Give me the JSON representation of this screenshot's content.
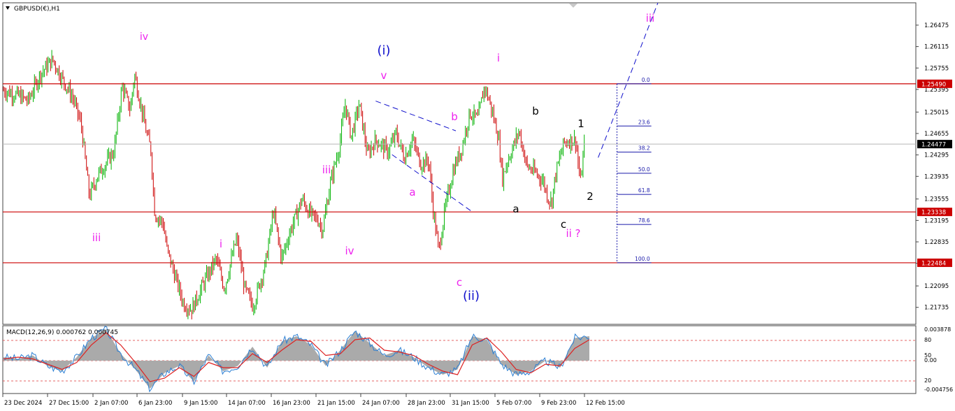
{
  "title": "GBPUSD(€),H1",
  "symbol_menu_icon": "triangle-down-icon",
  "colors": {
    "bull_candle": "#00b200",
    "bear_candle": "#cc0000",
    "hline": "#cc0000",
    "wave_magenta": "#ee22ee",
    "wave_blue": "#1010cc",
    "wave_black": "#000000",
    "fib": "#1a1aaa",
    "macd_hist": "#aaaaaa",
    "macd_line": "#2a7fd4",
    "signal_line": "#dd2222"
  },
  "chart_data": [
    {
      "type": "candlestick",
      "symbol": "GBPUSD",
      "timeframe": "H1",
      "ylim": [
        1.2145,
        1.2685
      ],
      "x_ticks": [
        "23 Dec 2024",
        "27 Dec 15:00",
        "2 Jan 07:00",
        "6 Jan 23:00",
        "9 Jan 15:00",
        "14 Jan 07:00",
        "16 Jan 23:00",
        "21 Jan 15:00",
        "24 Jan 07:00",
        "28 Jan 23:00",
        "31 Jan 15:00",
        "5 Feb 07:00",
        "9 Feb 23:00",
        "12 Feb 15:00"
      ],
      "y_ticks": [
        "1.26475",
        "1.26115",
        "1.25755",
        "1.25395",
        "1.25015",
        "1.24655",
        "1.24295",
        "1.23935",
        "1.23555",
        "1.23195",
        "1.22835",
        "1.22475",
        "1.22095",
        "1.21735"
      ],
      "price_labels": [
        "1.25490",
        "1.24477",
        "1.23338",
        "1.22484"
      ],
      "current_price": 1.24477,
      "horizontal_levels": [
        1.2549,
        1.23338,
        1.22484
      ],
      "path": [
        [
          0,
          1.2538
        ],
        [
          0.02,
          1.2528
        ],
        [
          0.03,
          1.252
        ],
        [
          0.045,
          1.2565
        ],
        [
          0.06,
          1.259
        ],
        [
          0.07,
          1.2562
        ],
        [
          0.085,
          1.2525
        ],
        [
          0.095,
          1.248
        ],
        [
          0.105,
          1.236
        ],
        [
          0.115,
          1.2395
        ],
        [
          0.135,
          1.2435
        ],
        [
          0.145,
          1.2545
        ],
        [
          0.155,
          1.2505
        ],
        [
          0.16,
          1.2565
        ],
        [
          0.175,
          1.2465
        ],
        [
          0.18,
          1.244
        ],
        [
          0.185,
          1.233
        ],
        [
          0.195,
          1.2315
        ],
        [
          0.2,
          1.227
        ],
        [
          0.21,
          1.2225
        ],
        [
          0.22,
          1.218
        ],
        [
          0.23,
          1.217
        ],
        [
          0.245,
          1.2215
        ],
        [
          0.26,
          1.2255
        ],
        [
          0.27,
          1.2205
        ],
        [
          0.285,
          1.229
        ],
        [
          0.295,
          1.2205
        ],
        [
          0.305,
          1.2175
        ],
        [
          0.32,
          1.2245
        ],
        [
          0.33,
          1.2335
        ],
        [
          0.34,
          1.2255
        ],
        [
          0.35,
          1.23
        ],
        [
          0.365,
          1.2355
        ],
        [
          0.375,
          1.233
        ],
        [
          0.385,
          1.232
        ],
        [
          0.39,
          1.2303
        ],
        [
          0.4,
          1.2385
        ],
        [
          0.41,
          1.244
        ],
        [
          0.418,
          1.2515
        ],
        [
          0.425,
          1.246
        ],
        [
          0.435,
          1.2515
        ],
        [
          0.445,
          1.243
        ],
        [
          0.455,
          1.2455
        ],
        [
          0.47,
          1.2435
        ],
        [
          0.48,
          1.2465
        ],
        [
          0.49,
          1.2425
        ],
        [
          0.5,
          1.2455
        ],
        [
          0.51,
          1.2415
        ],
        [
          0.52,
          1.242
        ],
        [
          0.525,
          1.234
        ],
        [
          0.53,
          1.229
        ],
        [
          0.532,
          1.2268
        ],
        [
          0.54,
          1.234
        ],
        [
          0.55,
          1.2405
        ],
        [
          0.56,
          1.244
        ],
        [
          0.57,
          1.25
        ],
        [
          0.58,
          1.249
        ],
        [
          0.588,
          1.2545
        ],
        [
          0.595,
          1.2515
        ],
        [
          0.605,
          1.246
        ],
        [
          0.61,
          1.239
        ],
        [
          0.615,
          1.2415
        ],
        [
          0.625,
          1.245
        ],
        [
          0.63,
          1.247
        ],
        [
          0.64,
          1.241
        ],
        [
          0.65,
          1.24
        ],
        [
          0.66,
          1.2385
        ],
        [
          0.665,
          1.236
        ],
        [
          0.67,
          1.235
        ],
        [
          0.675,
          1.2398
        ],
        [
          0.685,
          1.245
        ],
        [
          0.695,
          1.2455
        ],
        [
          0.7,
          1.2453
        ],
        [
          0.705,
          1.238
        ],
        [
          0.71,
          1.2445
        ]
      ],
      "annotations": [
        {
          "text": "iv",
          "color": "magenta"
        },
        {
          "text": "iii",
          "color": "magenta"
        },
        {
          "text": "i",
          "color": "magenta"
        },
        {
          "text": "iii",
          "color": "magenta"
        },
        {
          "text": "iv",
          "color": "magenta"
        },
        {
          "text": "v",
          "color": "magenta"
        },
        {
          "text": "(i)",
          "color": "blue"
        },
        {
          "text": "a",
          "color": "magenta"
        },
        {
          "text": "b",
          "color": "magenta"
        },
        {
          "text": "c",
          "color": "magenta"
        },
        {
          "text": "(ii)",
          "color": "blue"
        },
        {
          "text": "i",
          "color": "magenta"
        },
        {
          "text": "a",
          "color": "black"
        },
        {
          "text": "b",
          "color": "black"
        },
        {
          "text": "c",
          "color": "black"
        },
        {
          "text": "ii ?",
          "color": "magenta"
        },
        {
          "text": "1",
          "color": "black"
        },
        {
          "text": "2",
          "color": "black"
        },
        {
          "text": "iii",
          "color": "magenta"
        }
      ],
      "fibonacci": {
        "from": 1.22484,
        "to": 1.2549,
        "levels": [
          {
            "label": "0.0",
            "ratio": 0
          },
          {
            "label": "23.6",
            "ratio": 0.236
          },
          {
            "label": "38.2",
            "ratio": 0.382
          },
          {
            "label": "50.0",
            "ratio": 0.5
          },
          {
            "label": "61.8",
            "ratio": 0.618
          },
          {
            "label": "78.6",
            "ratio": 0.786
          },
          {
            "label": "100.0",
            "ratio": 1.0
          }
        ]
      }
    },
    {
      "type": "line",
      "title": "MACD(12,26,9) 0.000762 0.000745",
      "y_ticks_right": [
        "0.003878",
        "80",
        "50",
        "0.00",
        "20",
        "-0.004756"
      ],
      "dotted_levels": [
        80,
        50,
        20
      ],
      "series": [
        {
          "name": "histogram",
          "style": "area",
          "values": [
            0.2,
            0.1,
            0.3,
            -0.3,
            -0.6,
            0.2,
            1.3,
            1.8,
            0.4,
            -0.5,
            -1.6,
            -0.7,
            -0.3,
            -1.2,
            0.3,
            -0.6,
            -0.3,
            0.8,
            -0.4,
            1.1,
            1.4,
            0.9,
            -0.3,
            0.6,
            1.7,
            1.0,
            0.3,
            0.6,
            0.2,
            -0.4,
            -0.8,
            -0.5,
            1.4,
            1.2,
            -0.2,
            -0.8,
            -0.6,
            0.0,
            -0.4,
            1.3,
            1.4
          ]
        },
        {
          "name": "signal",
          "style": "line",
          "values": [
            0.1,
            0.2,
            0.1,
            -0.2,
            -0.5,
            -0.1,
            0.9,
            1.6,
            0.9,
            -0.1,
            -1.2,
            -1.0,
            -0.4,
            -0.9,
            -0.1,
            -0.4,
            -0.4,
            0.4,
            -0.1,
            0.6,
            1.2,
            1.1,
            0.3,
            0.4,
            1.2,
            1.3,
            0.6,
            0.5,
            0.3,
            -0.2,
            -0.6,
            -0.8,
            0.9,
            1.3,
            0.5,
            -0.5,
            -0.7,
            -0.2,
            -0.3,
            0.7,
            1.2
          ]
        }
      ]
    }
  ]
}
